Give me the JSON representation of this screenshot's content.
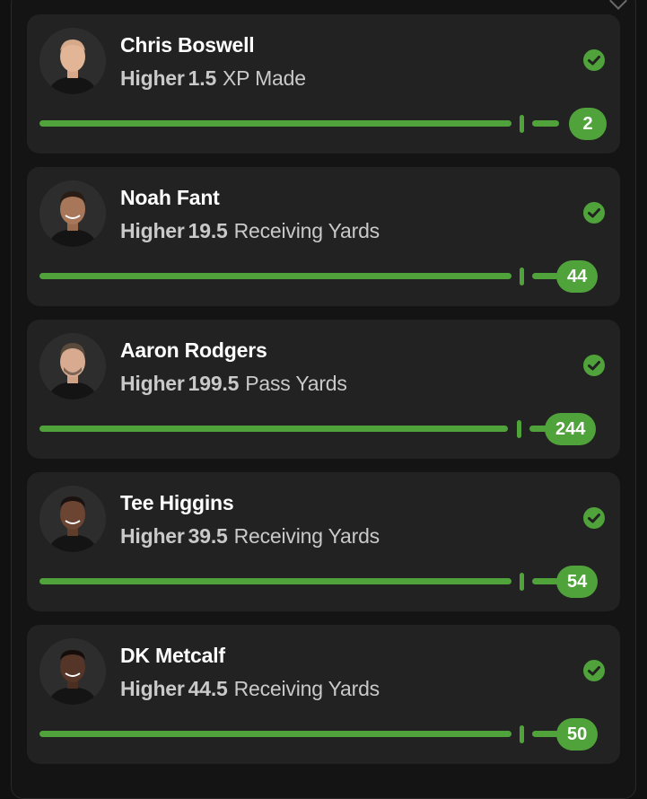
{
  "colors": {
    "page_bg": "#111111",
    "card_bg": "#222222",
    "accent_green": "#4fa33a",
    "name_text": "#ffffff",
    "secondary_text": "#c9c9c9"
  },
  "picks": [
    {
      "player": "Chris Boswell",
      "direction": "Higher",
      "line": "1.5",
      "stat": "XP Made",
      "result": "2",
      "status_icon": "check-circle-icon"
    },
    {
      "player": "Noah Fant",
      "direction": "Higher",
      "line": "19.5",
      "stat": "Receiving Yards",
      "result": "44",
      "status_icon": "check-circle-icon"
    },
    {
      "player": "Aaron Rodgers",
      "direction": "Higher",
      "line": "199.5",
      "stat": "Pass Yards",
      "result": "244",
      "status_icon": "check-circle-icon"
    },
    {
      "player": "Tee Higgins",
      "direction": "Higher",
      "line": "39.5",
      "stat": "Receiving Yards",
      "result": "54",
      "status_icon": "check-circle-icon"
    },
    {
      "player": "DK Metcalf",
      "direction": "Higher",
      "line": "44.5",
      "stat": "Receiving Yards",
      "result": "50",
      "status_icon": "check-circle-icon"
    }
  ]
}
